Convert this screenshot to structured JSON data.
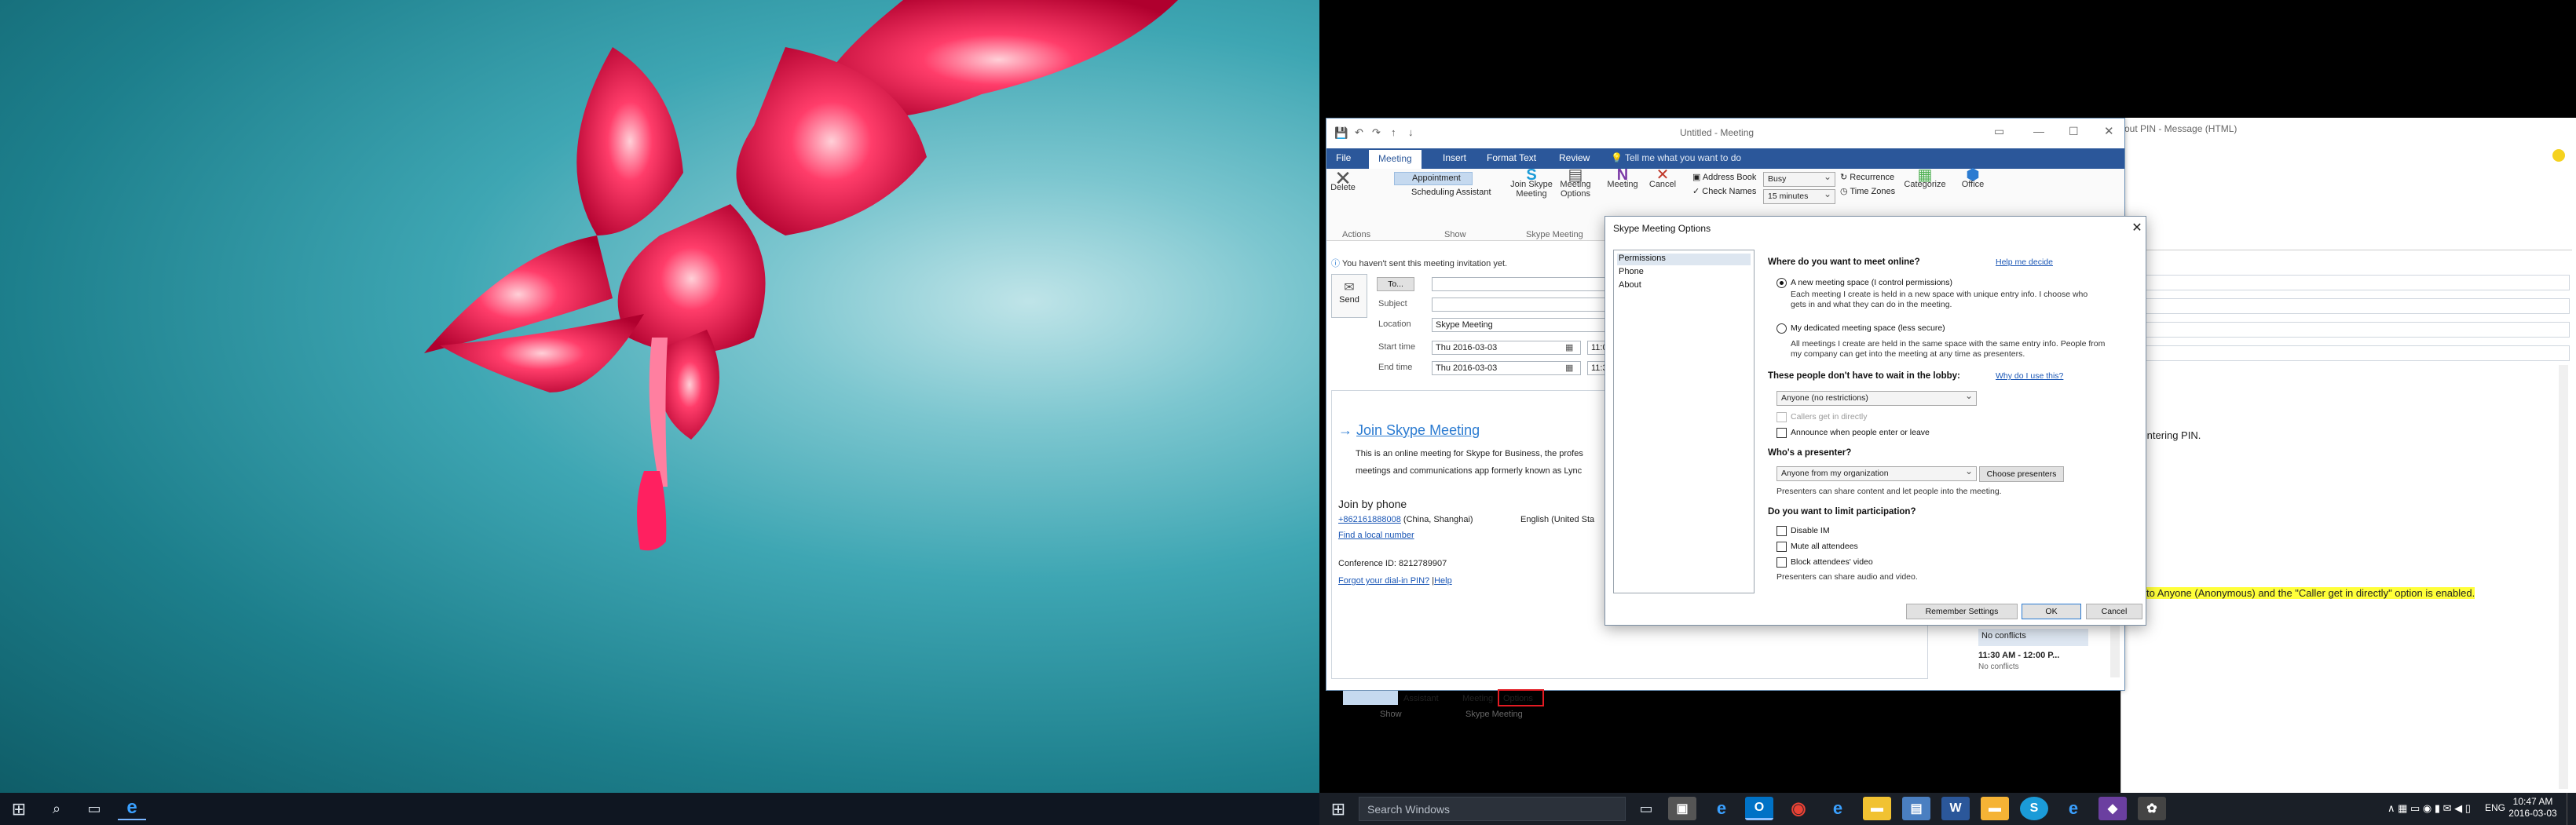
{
  "taskbar": {
    "search_placeholder": "Search Windows",
    "time": "10:47 AM",
    "date": "2016-03-03",
    "lang": "ENG"
  },
  "outlook": {
    "title": "Untitled - Meeting",
    "bg_message_title": "out PIN - Message (HTML)",
    "tell_me": "Tell me what you want to do",
    "tabs": [
      "File",
      "Meeting",
      "Insert",
      "Format Text",
      "Review"
    ],
    "ribbon": {
      "delete": "Delete",
      "actions": "Actions",
      "appointment": "Appointment",
      "scheduling_assistant": "Scheduling Assistant",
      "show": "Show",
      "join_skype": "Join Skype Meeting",
      "meeting_options": "Meeting Options",
      "skype_meeting": "Skype Meeting",
      "meeting_notes": "Meeting",
      "cancel": "Cancel",
      "address_book": "Address Book",
      "check_names": "Check Names",
      "busy": "Busy",
      "reminder": "15 minutes",
      "recurrence": "Recurrence",
      "time_zones": "Time Zones",
      "categorize": "Categorize",
      "office": "Office"
    },
    "info_bar": "You haven't sent this meeting invitation yet.",
    "form": {
      "send": "Send",
      "to_button": "To...",
      "subject_label": "Subject",
      "location_label": "Location",
      "location_value": "Skype Meeting",
      "start_label": "Start time",
      "start_date": "Thu 2016-03-03",
      "start_time": "11:0",
      "end_label": "End time",
      "end_date": "Thu 2016-03-03",
      "end_time": "11:3"
    },
    "body": {
      "join_link": "Join Skype Meeting",
      "desc1": "This is an online meeting for Skype for Business, the profes",
      "desc2": "meetings and communications app formerly known as Lync",
      "join_phone": "Join by phone",
      "phone_number": "+862161888008",
      "phone_city": "(China, Shanghai)",
      "phone_lang": "English (United Sta",
      "find_local": "Find a local number",
      "conf_id": "Conference ID: 8212789907",
      "forgot_pin": "Forgot your dial-in PIN?",
      "help": "Help"
    },
    "schedule": {
      "no_conflicts_1": "No conflicts",
      "slot": "11:30 AM - 12:00 P...",
      "no_conflicts_2": "No conflicts"
    },
    "msg_fragments": {
      "pin_text": "ut entering PIN.",
      "highlight_text": "set to Anyone (Anonymous) and the \"Caller get in directly\" option is enabled."
    },
    "bottom_ribbon": {
      "assistant": "Assistant",
      "meeting": "Meeting",
      "options": "Options",
      "show": "Show",
      "skype_meeting": "Skype Meeting"
    }
  },
  "dialog": {
    "title": "Skype Meeting Options",
    "nav": [
      "Permissions",
      "Phone",
      "About"
    ],
    "q_where": "Where do you want to meet online?",
    "help_decide": "Help me decide",
    "opt_new": "A new meeting space (I control permissions)",
    "opt_new_desc1": "Each meeting I create is held in a new space with unique entry info. I choose who",
    "opt_new_desc2": "gets in and what they can do in the meeting.",
    "opt_dedicated": "My dedicated meeting space (less secure)",
    "opt_ded_desc1": "All meetings I create are held in the same space with the same entry info. People from",
    "opt_ded_desc2": "my company can get into the meeting at any time as presenters.",
    "q_lobby": "These people don't have to wait in the lobby:",
    "why_use": "Why do I use this?",
    "lobby_value": "Anyone (no restrictions)",
    "callers_direct": "Callers get in directly",
    "announce": "Announce when people enter or leave",
    "q_presenter": "Who's a presenter?",
    "presenter_value": "Anyone from my organization",
    "choose_presenters": "Choose presenters",
    "presenter_desc": "Presenters can share content and let people into the meeting.",
    "q_limit": "Do you want to limit participation?",
    "disable_im": "Disable IM",
    "mute_all": "Mute all attendees",
    "block_video": "Block attendees' video",
    "presenter_av": "Presenters can share audio and video.",
    "remember": "Remember Settings",
    "ok": "OK",
    "cancel": "Cancel"
  }
}
